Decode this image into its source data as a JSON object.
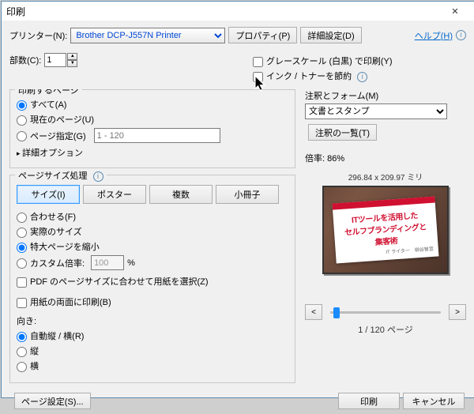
{
  "title": "印刷",
  "printer_label": "プリンター(N):",
  "printer_value": "Brother DCP-J557N Printer",
  "properties_btn": "プロパティ(P)",
  "advanced_btn": "詳細設定(D)",
  "help_link": "ヘルプ(H)",
  "copies_label": "部数(C):",
  "copies_value": "1",
  "grayscale": "グレースケール (白黒) で印刷(Y)",
  "save_ink": "インク / トナーを節約",
  "pages_group": "印刷するページ",
  "pages_all": "すべて(A)",
  "pages_current": "現在のページ(U)",
  "pages_range": "ページ指定(G)",
  "pages_range_hint": "1 - 120",
  "more_options": "詳細オプション",
  "sizing_group": "ページサイズ処理",
  "tab_size": "サイズ(I)",
  "tab_poster": "ポスター",
  "tab_multi": "複数",
  "tab_booklet": "小冊子",
  "fit": "合わせる(F)",
  "actual": "実際のサイズ",
  "shrink": "特大ページを縮小",
  "custom_scale": "カスタム倍率:",
  "custom_scale_val": "100",
  "percent": "%",
  "choose_paper": "PDF のページサイズに合わせて用紙を選択(Z)",
  "duplex": "用紙の両面に印刷(B)",
  "orient_label": "向き:",
  "orient_auto": "自動縦 / 横(R)",
  "orient_portrait": "縦",
  "orient_landscape": "横",
  "comments_label": "注釈とフォーム(M)",
  "comments_value": "文書とスタンプ",
  "summarize_btn": "注釈の一覧(T)",
  "scale_label": "倍率: ",
  "scale_value": "86%",
  "page_dims": "296.84 x 209.97 ミリ",
  "preview_line1": "ITツールを活用した",
  "preview_line2": "セルフブランディングと",
  "preview_line3": "集客術",
  "preview_sub": "IT ライター　柳谷智宣",
  "page_indicator_prefix": "1",
  "page_indicator_sep": " / ",
  "page_indicator_total": "120",
  "page_indicator_suffix": " ページ",
  "page_setup_btn": "ページ設定(S)...",
  "print_btn": "印刷",
  "cancel_btn": "キャンセル",
  "nav_prev": "<",
  "nav_next": ">"
}
